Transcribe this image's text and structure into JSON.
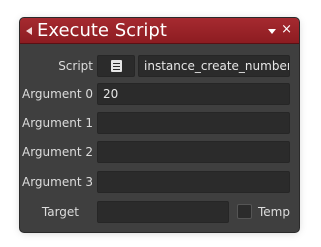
{
  "window": {
    "title": "Execute Script",
    "close_glyph": "×"
  },
  "form": {
    "script": {
      "label": "Script",
      "value": "instance_create_number"
    },
    "arguments": [
      {
        "label": "Argument 0",
        "value": "20"
      },
      {
        "label": "Argument 1",
        "value": ""
      },
      {
        "label": "Argument 2",
        "value": ""
      },
      {
        "label": "Argument 3",
        "value": ""
      }
    ],
    "target": {
      "label": "Target",
      "value": ""
    },
    "temp": {
      "label": "Temp",
      "checked": false
    }
  },
  "icons": {
    "collapse": "collapse-arrow-icon",
    "menu": "dropdown-arrow-icon",
    "close": "close-icon",
    "script_picker": "script-icon"
  },
  "colors": {
    "titlebar": "#9b2329",
    "panel": "#3f3f3f",
    "field": "#2b2b2b",
    "label_text": "#dcdcdc"
  }
}
